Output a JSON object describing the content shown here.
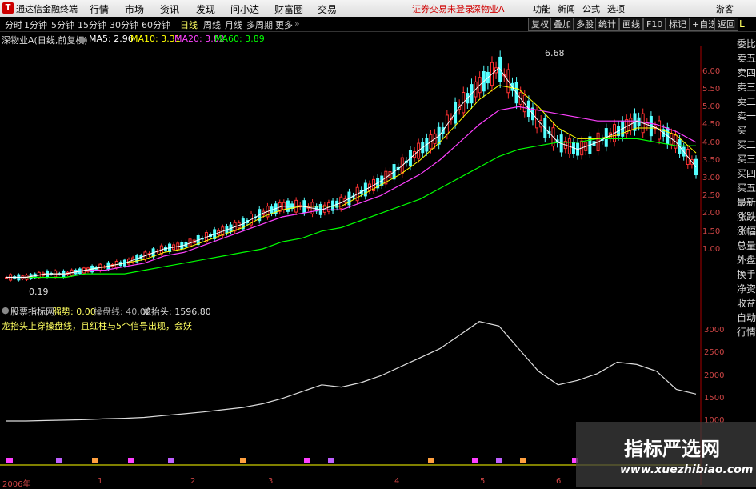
{
  "titlebar": {
    "app_title": "通达信金融终端",
    "menus": [
      "行情",
      "市场",
      "资讯",
      "发现",
      "问小达",
      "财富圈",
      "交易"
    ],
    "notice": "证券交易未登录",
    "stock": "深物业A",
    "right_menus": [
      "功能",
      "新闻",
      "公式",
      "选项"
    ],
    "guest": "游客"
  },
  "timeframes": [
    "分时",
    "1分钟",
    "5分钟",
    "15分钟",
    "30分钟",
    "60分钟",
    "日线",
    "周线",
    "月线",
    "多周期",
    "更多"
  ],
  "active_timeframe": "日线",
  "toolbar_right": [
    "复权",
    "叠加",
    "多股",
    "统计",
    "画线",
    "F10",
    "标记",
    "+自选",
    "返回"
  ],
  "main": {
    "title": "深物业A(日线,前复权)",
    "ma5": "MA5: 2.96",
    "ma10": "MA10: 3.31",
    "ma20": "MA20: 3.82",
    "ma60": "MA60: 3.89",
    "high_label": "6.68",
    "low_label": "0.19",
    "y_ticks": [
      "6.00",
      "5.50",
      "5.00",
      "4.50",
      "4.00",
      "3.50",
      "3.00",
      "2.50",
      "2.00",
      "1.50",
      "1.00"
    ]
  },
  "indicator": {
    "source": "股票指标网",
    "trend": "强势: 0.00",
    "line": "操盘线: 40.00",
    "dragon": "龙抬头: 1596.80",
    "note": "龙抬头上穿操盘线，且红柱与5个信号出现，会妖",
    "y_ticks": [
      "3000",
      "2500",
      "2000",
      "1500",
      "1000"
    ]
  },
  "x_dates": [
    "2006年",
    "1",
    "2",
    "3",
    "4",
    "5",
    "6"
  ],
  "side_items": [
    "委比",
    "卖五",
    "卖四",
    "卖三",
    "卖二",
    "卖一",
    "买一",
    "买二",
    "买三",
    "买四",
    "买五",
    "最新",
    "涨跌",
    "涨幅",
    "总量",
    "外盘",
    "换手",
    "净资",
    "收益",
    "自动",
    "行情"
  ],
  "watermark": {
    "cn": "指标严选网",
    "url": "www.xuezhibiao.com"
  },
  "colors": {
    "ma5": "#ffffff",
    "ma10": "#ffff00",
    "ma20": "#ff40ff",
    "ma60": "#00ff00",
    "up": "#ff3232",
    "down": "#54ffff"
  },
  "chart_data": {
    "type": "line",
    "ma5": [
      0.2,
      0.2,
      0.3,
      0.3,
      0.4,
      0.5,
      0.6,
      0.8,
      1.0,
      1.1,
      1.3,
      1.5,
      1.7,
      2.0,
      2.2,
      2.2,
      2.1,
      2.3,
      2.6,
      2.9,
      3.3,
      3.8,
      4.2,
      5.0,
      5.6,
      6.1,
      5.3,
      4.6,
      4.0,
      3.8,
      4.0,
      4.3,
      4.6,
      4.4,
      4.0,
      3.3
    ],
    "ma10": [
      0.2,
      0.2,
      0.3,
      0.3,
      0.4,
      0.5,
      0.6,
      0.7,
      0.9,
      1.0,
      1.2,
      1.4,
      1.6,
      1.9,
      2.1,
      2.2,
      2.2,
      2.2,
      2.5,
      2.8,
      3.1,
      3.5,
      4.0,
      4.6,
      5.2,
      5.6,
      5.5,
      5.0,
      4.4,
      4.1,
      4.1,
      4.2,
      4.4,
      4.4,
      4.2,
      3.7
    ],
    "ma20": [
      0.2,
      0.2,
      0.3,
      0.3,
      0.4,
      0.4,
      0.5,
      0.6,
      0.8,
      0.9,
      1.1,
      1.3,
      1.5,
      1.7,
      1.9,
      2.0,
      2.1,
      2.1,
      2.3,
      2.5,
      2.8,
      3.1,
      3.5,
      4.0,
      4.5,
      4.9,
      5.0,
      4.9,
      4.8,
      4.7,
      4.6,
      4.6,
      4.6,
      4.5,
      4.3,
      4.0
    ],
    "ma60": [
      0.2,
      0.2,
      0.2,
      0.2,
      0.3,
      0.3,
      0.3,
      0.4,
      0.5,
      0.6,
      0.7,
      0.8,
      0.9,
      1.0,
      1.2,
      1.3,
      1.5,
      1.6,
      1.8,
      2.0,
      2.2,
      2.4,
      2.7,
      3.0,
      3.3,
      3.6,
      3.8,
      3.9,
      4.0,
      4.0,
      4.1,
      4.1,
      4.1,
      4.0,
      3.9,
      3.9
    ],
    "indicator_line": [
      1000,
      1000,
      1010,
      1020,
      1030,
      1050,
      1060,
      1080,
      1120,
      1160,
      1200,
      1250,
      1300,
      1380,
      1500,
      1650,
      1800,
      1750,
      1850,
      2000,
      2200,
      2400,
      2600,
      2900,
      3200,
      3100,
      2600,
      2100,
      1800,
      1900,
      2050,
      2300,
      2250,
      2100,
      1700,
      1596
    ]
  }
}
